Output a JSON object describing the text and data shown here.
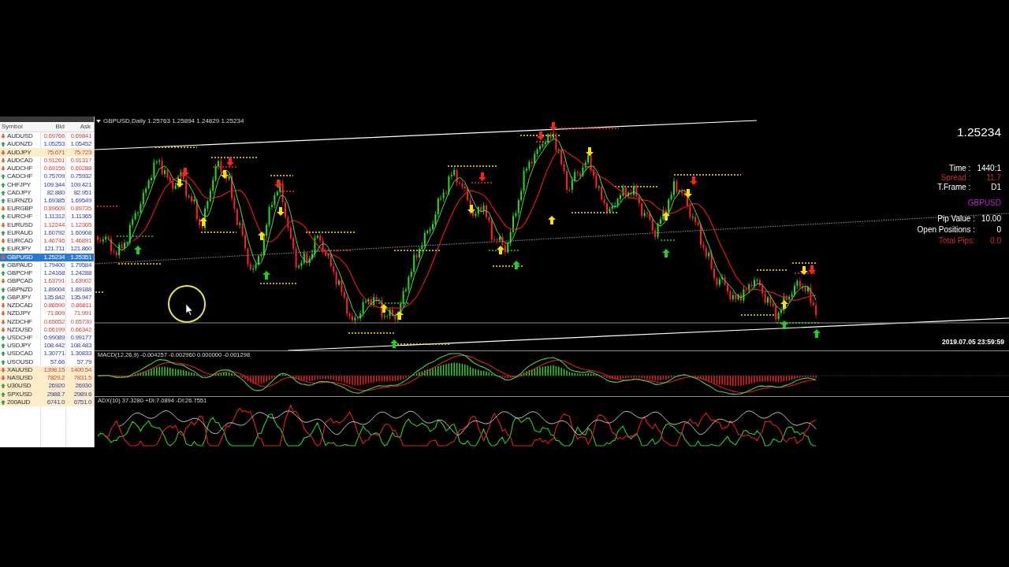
{
  "market_watch": {
    "columns": [
      "Symbol",
      "Bid",
      "Ask"
    ],
    "rows": [
      {
        "symbol": "AUDUSD",
        "bid": "0.69766",
        "ask": "0.69841",
        "rising": false,
        "selected": false,
        "highlighted": false
      },
      {
        "symbol": "AUDNZD",
        "bid": "1.05253",
        "ask": "1.05452",
        "rising": true,
        "selected": false,
        "highlighted": false
      },
      {
        "symbol": "AUDJPY",
        "bid": "75.671",
        "ask": "75.723",
        "rising": false,
        "selected": false,
        "highlighted": true
      },
      {
        "symbol": "AUDCAD",
        "bid": "0.91261",
        "ask": "0.91317",
        "rising": false,
        "selected": false,
        "highlighted": false
      },
      {
        "symbol": "AUDCHF",
        "bid": "0.69156",
        "ask": "0.69288",
        "rising": false,
        "selected": false,
        "highlighted": false
      },
      {
        "symbol": "CADCHF",
        "bid": "0.75709",
        "ask": "0.75932",
        "rising": true,
        "selected": false,
        "highlighted": false
      },
      {
        "symbol": "CHFJPY",
        "bid": "109.344",
        "ask": "109.421",
        "rising": true,
        "selected": false,
        "highlighted": false
      },
      {
        "symbol": "CADJPY",
        "bid": "82.880",
        "ask": "82.951",
        "rising": true,
        "selected": false,
        "highlighted": false
      },
      {
        "symbol": "EURNZD",
        "bid": "1.69385",
        "ask": "1.69549",
        "rising": true,
        "selected": false,
        "highlighted": false
      },
      {
        "symbol": "EURGBP",
        "bid": "0.89609",
        "ask": "0.89735",
        "rising": false,
        "selected": false,
        "highlighted": false
      },
      {
        "symbol": "EURCHF",
        "bid": "1.11312",
        "ask": "1.11365",
        "rising": true,
        "selected": false,
        "highlighted": false
      },
      {
        "symbol": "EURUSD",
        "bid": "1.12244",
        "ask": "1.12305",
        "rising": false,
        "selected": false,
        "highlighted": false
      },
      {
        "symbol": "EURAUD",
        "bid": "1.60792",
        "ask": "1.60908",
        "rising": true,
        "selected": false,
        "highlighted": false
      },
      {
        "symbol": "EURCAD",
        "bid": "1.46746",
        "ask": "1.46891",
        "rising": false,
        "selected": false,
        "highlighted": false
      },
      {
        "symbol": "EURJPY",
        "bid": "121.711",
        "ask": "121.860",
        "rising": true,
        "selected": false,
        "highlighted": false
      },
      {
        "symbol": "GBPUSD",
        "bid": "1.25234",
        "ask": "1.25351",
        "rising": false,
        "selected": true,
        "highlighted": false
      },
      {
        "symbol": "GBPAUD",
        "bid": "1.79400",
        "ask": "1.79584",
        "rising": true,
        "selected": false,
        "highlighted": false
      },
      {
        "symbol": "GBPCHF",
        "bid": "1.24168",
        "ask": "1.24288",
        "rising": true,
        "selected": false,
        "highlighted": false
      },
      {
        "symbol": "GBPCAD",
        "bid": "1.63791",
        "ask": "1.63902",
        "rising": false,
        "selected": false,
        "highlighted": false
      },
      {
        "symbol": "GBPNZD",
        "bid": "1.89004",
        "ask": "1.89188",
        "rising": true,
        "selected": false,
        "highlighted": false
      },
      {
        "symbol": "GBPJPY",
        "bid": "135.842",
        "ask": "135.947",
        "rising": true,
        "selected": false,
        "highlighted": false
      },
      {
        "symbol": "NZDCAD",
        "bid": "0.86590",
        "ask": "0.86811",
        "rising": false,
        "selected": false,
        "highlighted": false
      },
      {
        "symbol": "NZDJPY",
        "bid": "71.809",
        "ask": "71.991",
        "rising": false,
        "selected": false,
        "highlighted": false
      },
      {
        "symbol": "NZDCHF",
        "bid": "0.65652",
        "ask": "0.65730",
        "rising": false,
        "selected": false,
        "highlighted": false
      },
      {
        "symbol": "NZDUSD",
        "bid": "0.66199",
        "ask": "0.66342",
        "rising": false,
        "selected": false,
        "highlighted": false
      },
      {
        "symbol": "USDCHF",
        "bid": "0.99089",
        "ask": "0.99177",
        "rising": true,
        "selected": false,
        "highlighted": false
      },
      {
        "symbol": "USDJPY",
        "bid": "108.442",
        "ask": "108.483",
        "rising": true,
        "selected": false,
        "highlighted": false
      },
      {
        "symbol": "USDCAD",
        "bid": "1.30771",
        "ask": "1.30833",
        "rising": true,
        "selected": false,
        "highlighted": false
      },
      {
        "symbol": "USOUSD",
        "bid": "57.66",
        "ask": "57.79",
        "rising": true,
        "selected": false,
        "highlighted": false
      },
      {
        "symbol": "XAUUSD",
        "bid": "1398.15",
        "ask": "1400.54",
        "rising": false,
        "selected": false,
        "highlighted": true
      },
      {
        "symbol": "NASUSD",
        "bid": "7829.2",
        "ask": "7831.5",
        "rising": false,
        "selected": false,
        "highlighted": true
      },
      {
        "symbol": "U30USD",
        "bid": "26920",
        "ask": "26930",
        "rising": true,
        "selected": false,
        "highlighted": true
      },
      {
        "symbol": "SPXUSD",
        "bid": "2988.7",
        "ask": "2989.6",
        "rising": true,
        "selected": false,
        "highlighted": true
      },
      {
        "symbol": "200AUD",
        "bid": "6741.0",
        "ask": "6751.0",
        "rising": true,
        "selected": false,
        "highlighted": true
      }
    ]
  },
  "chart": {
    "header": "GBPUSD,Daily 1.25763 1.25894 1.24829 1.25234",
    "price": "1.25234",
    "info": [
      {
        "label": "Time :",
        "value": "1440:1",
        "alert": false
      },
      {
        "label": "Spread :",
        "value": "11.7",
        "alert": true
      },
      {
        "label": "T.Frame :",
        "value": "D1",
        "alert": false
      }
    ],
    "symbol": "GBPUSD",
    "account": [
      {
        "label": "Pip Value :",
        "value": "10.00",
        "alert": false
      },
      {
        "label": "Open Positions :",
        "value": "0",
        "alert": false
      },
      {
        "label": "Total Pips:",
        "value": "0.0",
        "alert": true
      }
    ],
    "timestamp": "2019.07.05 23:59:59"
  },
  "indicators": [
    {
      "kind": "macd",
      "label": "MACD(12,26,9) -0.004257 -0.002960 0.000000 -0.001298"
    },
    {
      "kind": "adx",
      "label": "ADX(10) 37.3280 +DI:7.0894 -DI:26.7551"
    }
  ]
}
